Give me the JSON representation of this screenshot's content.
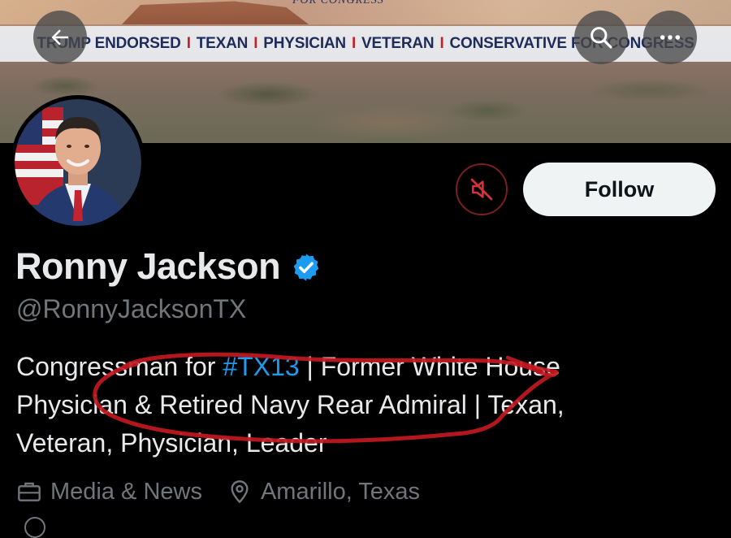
{
  "banner": {
    "top_text": "FOR CONGRESS",
    "slogan": [
      "TRUMP ENDORSED",
      "TEXAN",
      "PHYSICIAN",
      "VETERAN",
      "CONSERVATIVE FOR CONGRESS"
    ],
    "slogan_separator": "I"
  },
  "nav": {
    "back_icon": "arrow-left-icon",
    "search_icon": "search-icon",
    "more_icon": "more-horizontal-icon"
  },
  "profile": {
    "display_name": "Ronny Jackson",
    "verified_icon": "verified-badge-icon",
    "handle": "@RonnyJacksonTX",
    "bio": {
      "line1_a": "Congressman for ",
      "hashtag": "#TX13",
      "line1_b": " | Former White House",
      "line2": "Physician & Retired Navy Rear Admiral | Texan,",
      "line3": "Veteran, Physician, Leader"
    },
    "category": "Media & News",
    "category_icon": "briefcase-icon",
    "location": "Amarillo, Texas",
    "location_icon": "location-pin-icon"
  },
  "actions": {
    "mute_icon": "muted-speaker-icon",
    "follow_label": "Follow"
  },
  "colors": {
    "accent": "#1d9bf0",
    "annotation": "#c3181f",
    "slogan_text": "#1e2c5b",
    "slogan_separator": "#c3242a"
  }
}
